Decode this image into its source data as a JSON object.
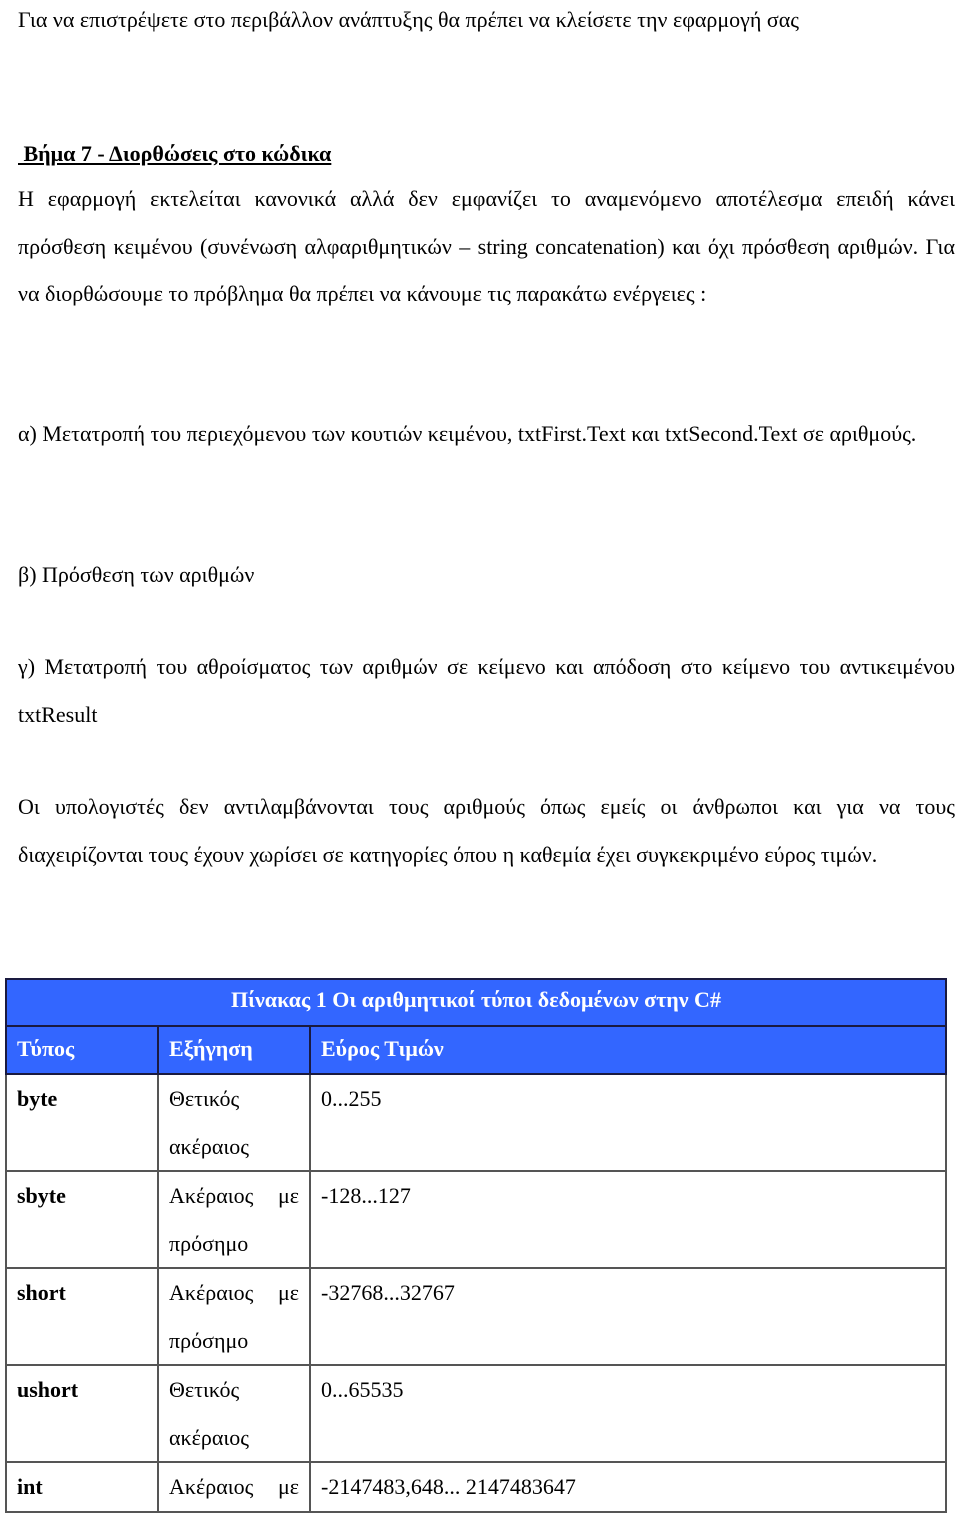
{
  "document": {
    "intro_paragraph": "Για να επιστρέψετε στο περιβάλλον ανάπτυξης θα πρέπει να κλείσετε την εφαρμογή σας",
    "step_heading": " Βήμα 7 - Διορθώσεις στο κώδικα",
    "explanation_paragraph": "Η εφαρμογή εκτελείται κανονικά αλλά δεν εμφανίζει το αναμενόμενο αποτέλεσμα επειδή κάνει πρόσθεση κειμένου (συνένωση αλφαριθμητικών – string concatenation) και όχι πρόσθεση αριθμών. Για να διορθώσουμε το πρόβλημα θα πρέπει να κάνουμε τις παρακάτω ενέργειες :",
    "steps": [
      "α) Μετατροπή του περιεχόμενου των κουτιών κειμένου, txtFirst.Text και txtSecond.Text σε αριθμούς.",
      "β) Πρόσθεση των αριθμών",
      "γ) Μετατροπή του αθροίσματος των αριθμών σε κείμενο και απόδοση στο κείμενο του αντικειμένου txtResult"
    ],
    "computers_paragraph": "Οι υπολογιστές δεν αντιλαμβάνονται τους αριθμούς όπως εμείς οι άνθρωποι και για να τους διαχειρίζονται τους έχουν χωρίσει σε κατηγορίες όπου η καθεμία έχει συγκεκριμένο εύρος τιμών."
  },
  "table": {
    "caption": "Πίνακας 1 Οι αριθμητικοί τύποι δεδομένων στην C#",
    "header_color": "#3366ff",
    "columns": [
      "Τύπος",
      "Εξήγηση",
      "Εύρος Τιμών"
    ],
    "rows": [
      {
        "type": "byte",
        "desc_line1": "Θετικός",
        "desc_line2": "ακέραιος",
        "range": "0...255"
      },
      {
        "type": "sbyte",
        "desc_line1": "Ακέραιος με",
        "desc_line2": "πρόσημο",
        "range": "-128...127"
      },
      {
        "type": "short",
        "desc_line1": "Ακέραιος με",
        "desc_line2": "πρόσημο",
        "range": "-32768...32767"
      },
      {
        "type": "ushort",
        "desc_line1": "Θετικός",
        "desc_line2": "ακέραιος",
        "range": "0...65535"
      },
      {
        "type": "int",
        "desc_line1": "Ακέραιος με",
        "desc_line2": "",
        "range": "-2147483,648... 2147483647"
      }
    ]
  }
}
